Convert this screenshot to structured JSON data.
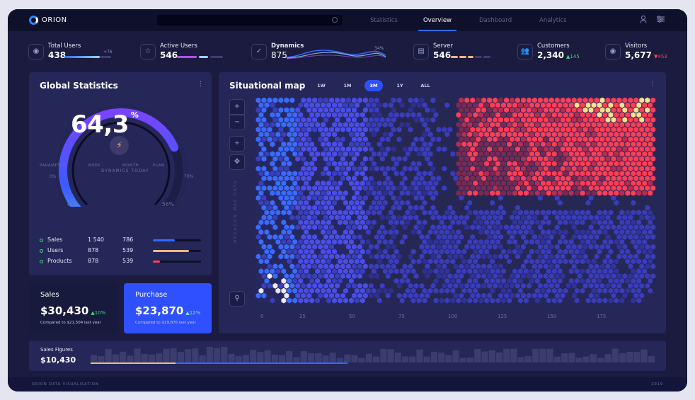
{
  "app": {
    "logo_text": "ORION",
    "footer_left": "ORION DATA VISUALISATION",
    "footer_right": "2019"
  },
  "nav": {
    "tabs": [
      "Statistics",
      "Overview",
      "Dashboard",
      "Analytics"
    ],
    "active": "Overview"
  },
  "kpis": [
    {
      "label": "Total Users",
      "value": "438",
      "delta": "+76",
      "icon": "eye-icon"
    },
    {
      "label": "Active Users",
      "value": "546",
      "icon": "user-star-icon"
    },
    {
      "label": "Dynamics",
      "value": "875",
      "delta": "34%",
      "icon": "check-circle-icon"
    },
    {
      "label": "Server",
      "value": "546",
      "icon": "server-icon"
    },
    {
      "label": "Customers",
      "value": "2,340",
      "delta": "145",
      "icon": "users-icon"
    },
    {
      "label": "Visitors",
      "value": "5,677",
      "delta": "453",
      "icon": "eye-icon"
    }
  ],
  "global_stats": {
    "title": "Global Statistics",
    "gauge_label": "DYNAMICS TODAY",
    "gauge_value": "64,3",
    "gauge_unit": "%",
    "gauge_level": 0.643,
    "gauge_left_outer": "0%",
    "gauge_right_outer": "70%",
    "gauge_left_inner": "0%",
    "gauge_right_inner": "56%",
    "columns": [
      "PARAMETER",
      "WEEK",
      "MONTH",
      "PLAN"
    ],
    "rows": [
      {
        "param": "Sales",
        "week": "1 540",
        "month": "786",
        "plan": 0.45,
        "color": "#2e6bff"
      },
      {
        "param": "Users",
        "week": "878",
        "month": "539",
        "plan": 0.75,
        "color": "#f2b77d"
      },
      {
        "param": "Products",
        "week": "878",
        "month": "539",
        "plan": 0.15,
        "color": "#ff3d55"
      }
    ]
  },
  "sales_card": {
    "title": "Sales",
    "value": "$30,430",
    "delta": "10%",
    "subtitle": "Compared to $21,504 last year"
  },
  "purchase_card": {
    "title": "Purchase",
    "value": "$23,870",
    "delta": "12%",
    "subtitle": "Compared to $19,876 last year"
  },
  "map": {
    "title": "Situational map",
    "ranges": [
      "1W",
      "1M",
      "3M",
      "1Y",
      "ALL"
    ],
    "active_range": "3M",
    "vertical_label": "HEXAGON MAP DATA",
    "x_ticks": [
      "0",
      "25",
      "50",
      "75",
      "100",
      "125",
      "150",
      "175"
    ]
  },
  "sales_figures": {
    "label": "Sales Figures",
    "value": "$10,430"
  },
  "colors": {
    "blue": "#2e6bff",
    "red": "#ff3d55",
    "peach": "#f2b77d",
    "green": "#3fd47b"
  }
}
